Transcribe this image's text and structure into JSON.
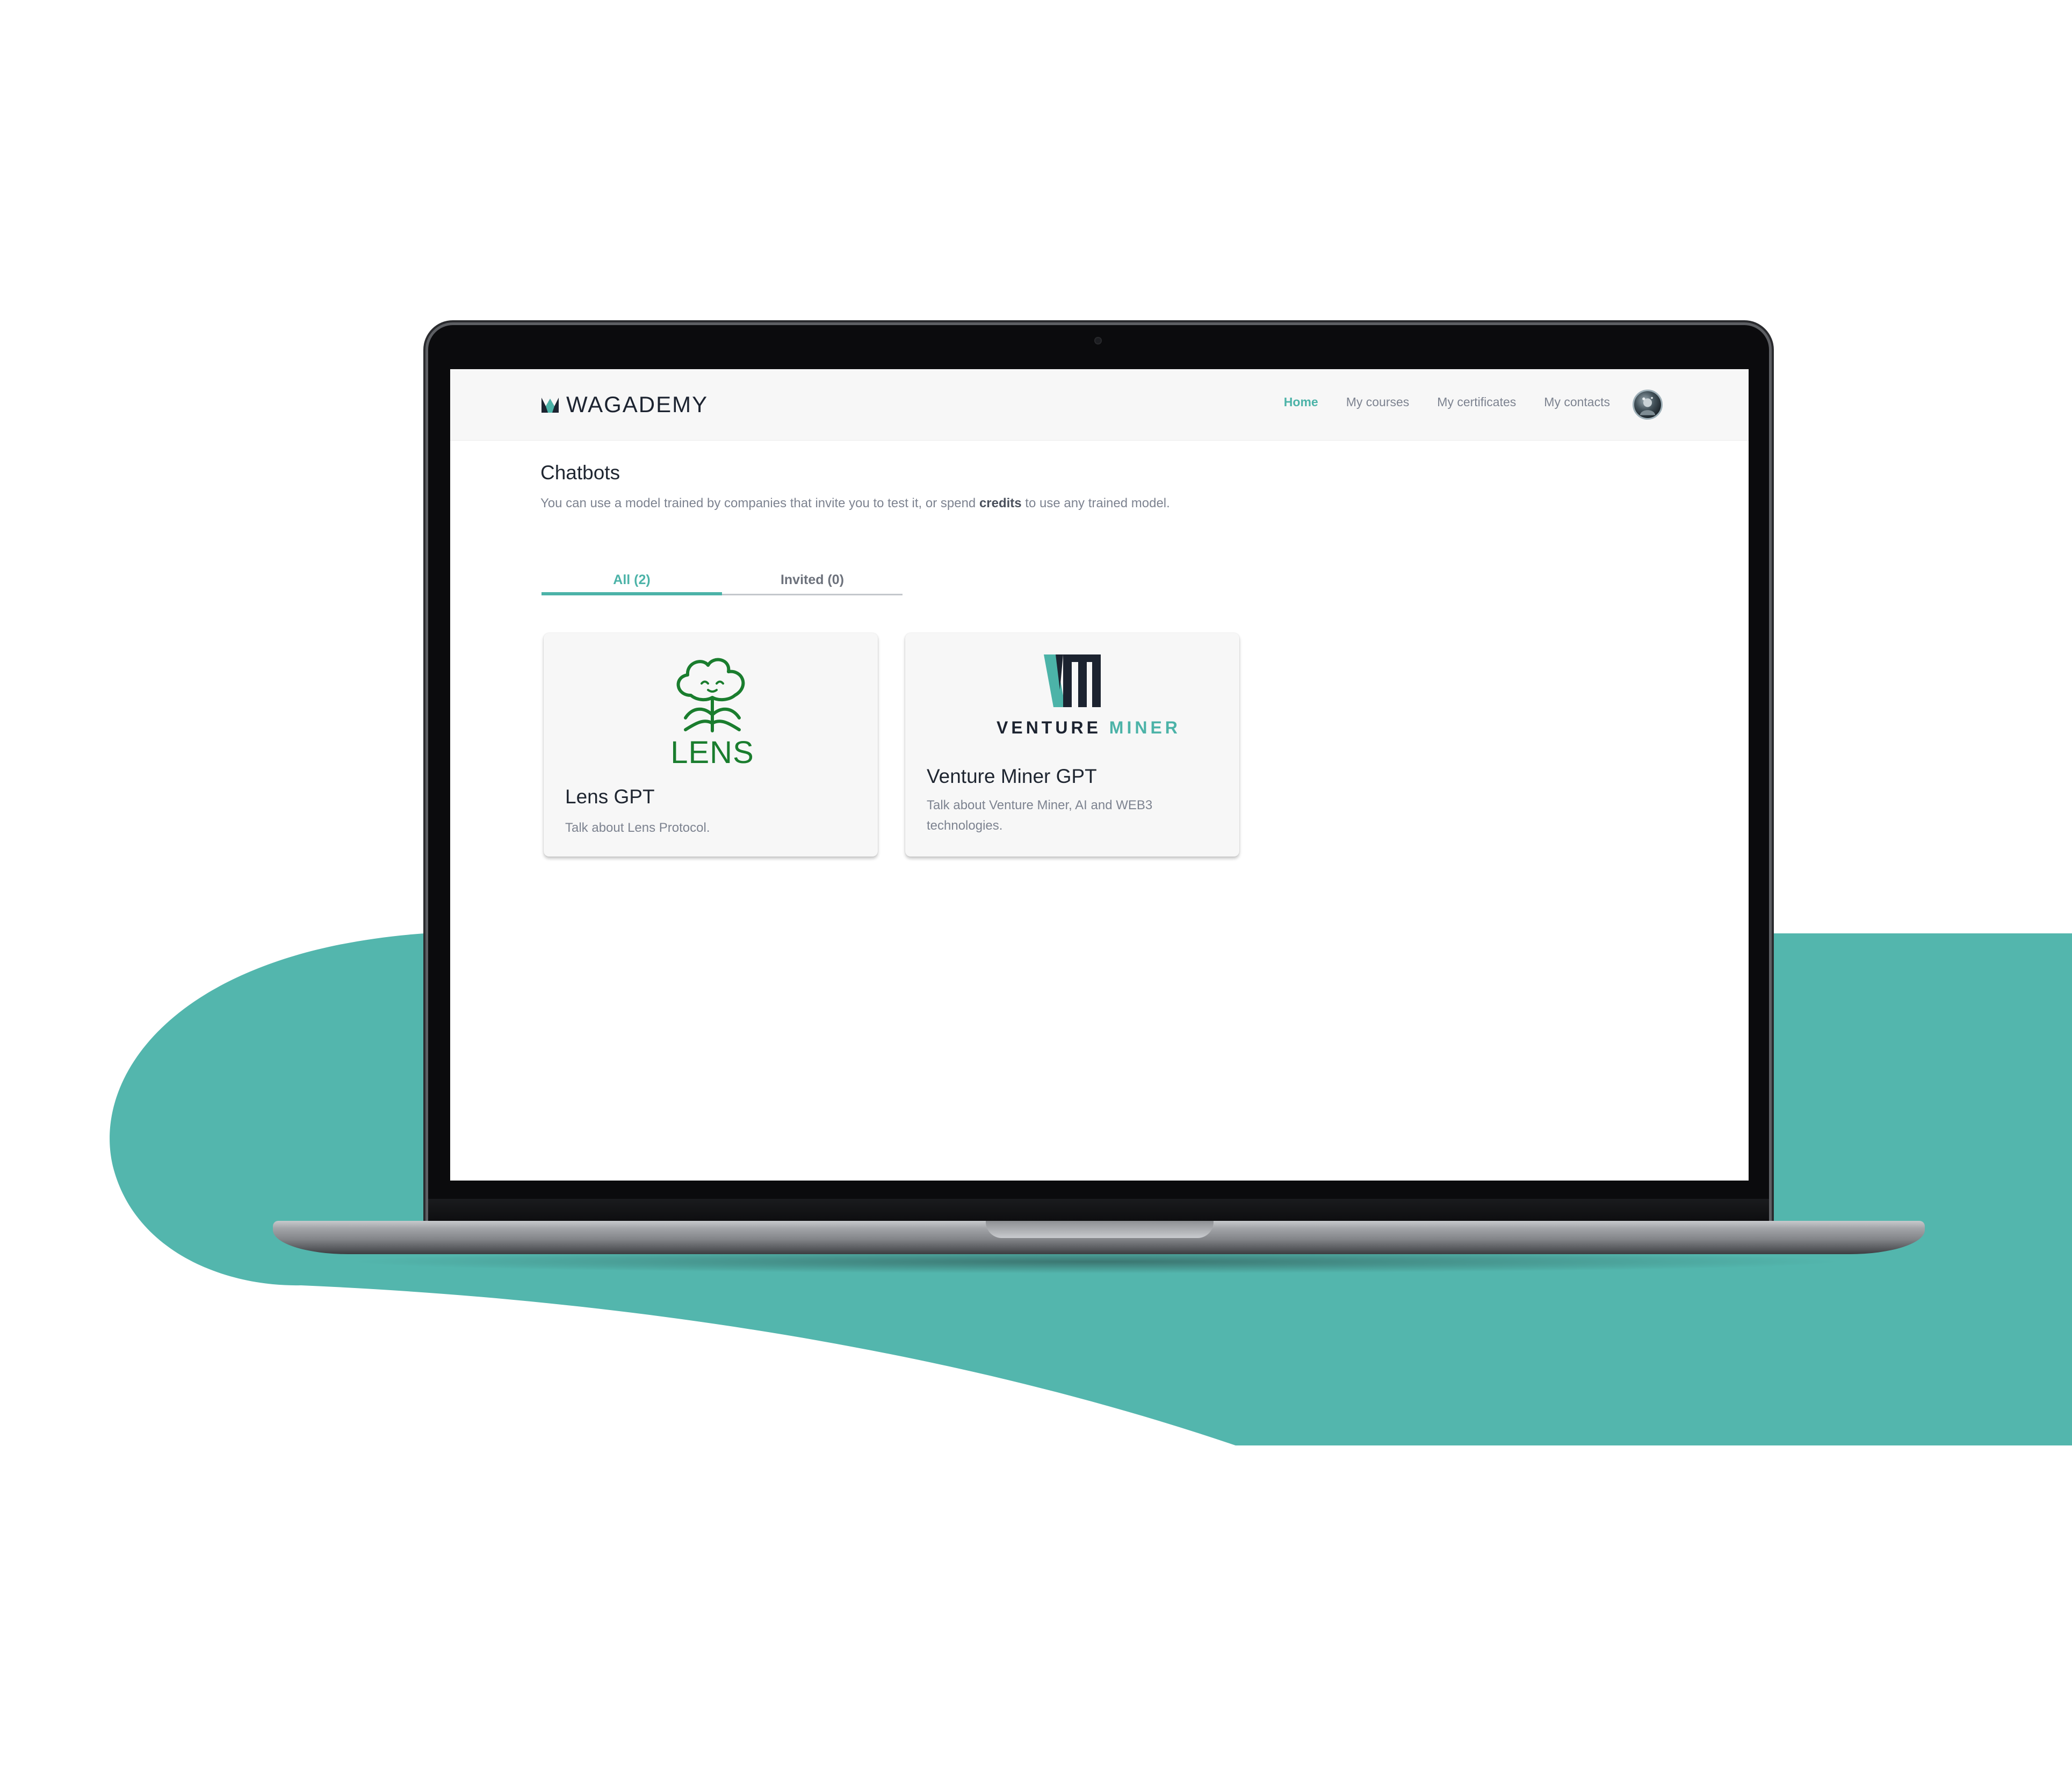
{
  "colors": {
    "accent": "#4cb3a8",
    "brand_dark": "#1c2330",
    "lens_green": "#1a7d2e",
    "backdrop_teal": "#53b6ad"
  },
  "header": {
    "brand": "WAGADEMY",
    "nav": [
      {
        "label": "Home",
        "active": true
      },
      {
        "label": "My courses",
        "active": false
      },
      {
        "label": "My certificates",
        "active": false
      },
      {
        "label": "My contacts",
        "active": false
      }
    ],
    "avatar_icon": "user-avatar-icon"
  },
  "main": {
    "title": "Chatbots",
    "subtitle_before": "You can use a model trained by companies that invite you to test it, or spend ",
    "subtitle_bold": "credits",
    "subtitle_after": " to use any trained model.",
    "tabs": [
      {
        "label": "All (2)",
        "active": true
      },
      {
        "label": "Invited (0)",
        "active": false
      }
    ],
    "cards": [
      {
        "logo_text": "LENS",
        "title": "Lens GPT",
        "description": "Talk about Lens Protocol."
      },
      {
        "logo_text_1": "VENTURE",
        "logo_text_2": "MINER",
        "title": "Venture Miner GPT",
        "description": "Talk about Venture Miner, AI and WEB3 technologies."
      }
    ]
  }
}
